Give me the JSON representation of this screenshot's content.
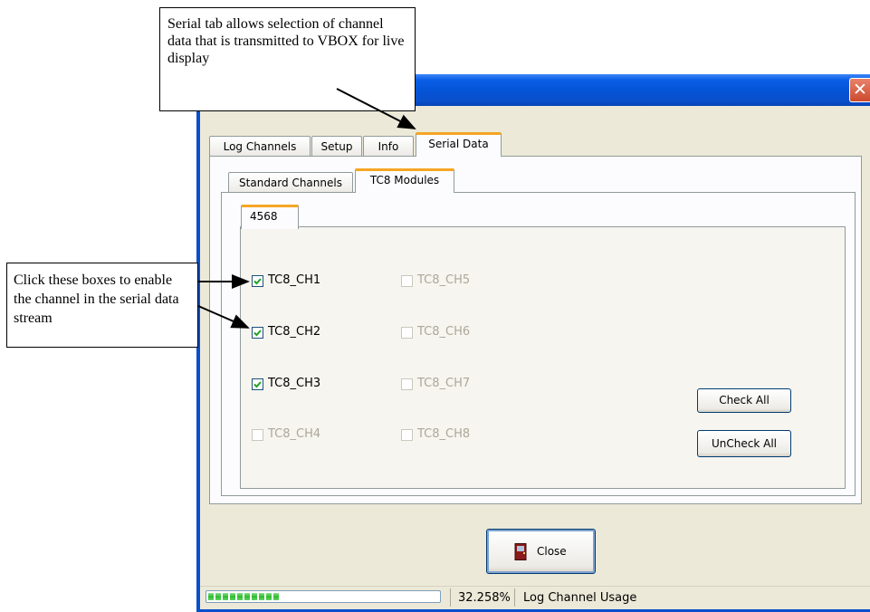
{
  "window": {
    "close_glyph": "✕"
  },
  "tabs_main": [
    "Log Channels",
    "Setup",
    "Info",
    "Serial Data"
  ],
  "tabs_sub": [
    "Standard Channels",
    "TC8 Modules"
  ],
  "tabs_module": [
    "4568"
  ],
  "channels": [
    {
      "label": "TC8_CH1",
      "checked": true,
      "enabled": true
    },
    {
      "label": "TC8_CH2",
      "checked": true,
      "enabled": true
    },
    {
      "label": "TC8_CH3",
      "checked": true,
      "enabled": true
    },
    {
      "label": "TC8_CH4",
      "checked": false,
      "enabled": false
    },
    {
      "label": "TC8_CH5",
      "checked": false,
      "enabled": false
    },
    {
      "label": "TC8_CH6",
      "checked": false,
      "enabled": false
    },
    {
      "label": "TC8_CH7",
      "checked": false,
      "enabled": false
    },
    {
      "label": "TC8_CH8",
      "checked": false,
      "enabled": false
    }
  ],
  "buttons": {
    "check_all": "Check All",
    "uncheck_all": "UnCheck All",
    "close": "Close"
  },
  "statusbar": {
    "progress_fraction": 0.32258,
    "percent_text": "32.258%",
    "usage_label": "Log Channel Usage"
  },
  "callouts": {
    "serial_tab": "Serial tab allows selection of channel data that is transmitted to VBOX for live display",
    "click_boxes": "Click these boxes to enable the channel in the serial data stream"
  },
  "colors": {
    "titlebar": "#0553d6",
    "active_tab_accent": "#f5a623",
    "progress_fill": "#2dbc2d"
  },
  "icons": {
    "close_window": "close-x-icon",
    "close_button": "door-exit-icon",
    "checkmark": "checkmark-icon"
  }
}
